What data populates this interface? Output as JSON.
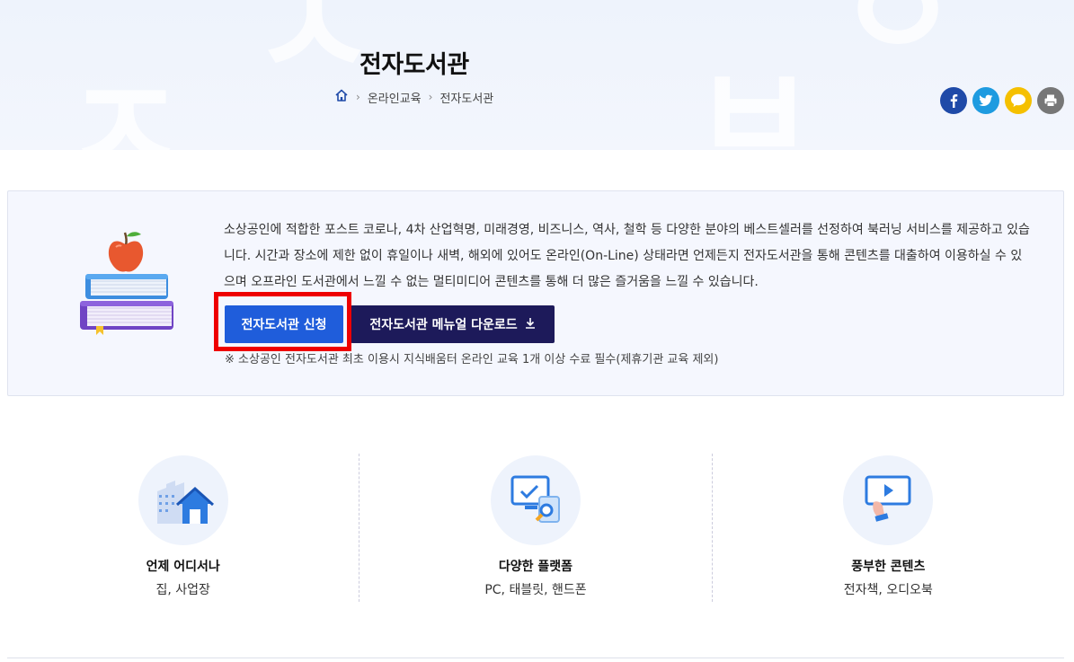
{
  "header": {
    "title": "전자도서관",
    "breadcrumb": [
      {
        "label": "온라인교육"
      },
      {
        "label": "전자도서관"
      }
    ],
    "share_icons": [
      {
        "icon": "facebook-icon",
        "glyph": "f",
        "color": "#1f4aa8"
      },
      {
        "icon": "twitter-icon",
        "glyph": "t",
        "color": "#1e9be0"
      },
      {
        "icon": "kakaotalk-icon",
        "glyph": "k",
        "color": "#f5c000"
      },
      {
        "icon": "print-icon",
        "glyph": "p",
        "color": "#777777"
      }
    ]
  },
  "info": {
    "description": "소상공인에 적합한 포스트 코로나, 4차 산업혁명, 미래경영, 비즈니스, 역사, 철학 등 다양한 분야의 베스트셀러를 선정하여 북러닝 서비스를 제공하고 있습니다. 시간과 장소에 제한 없이 휴일이나 새벽, 해외에 있어도 온라인(On-Line) 상태라면 언제든지 전자도서관을 통해 콘텐츠를 대출하여 이용하실 수 있으며 오프라인 도서관에서 느낄 수 없는 멀티미디어 콘텐츠를 통해 더 많은 즐거움을 느낄 수 있습니다.",
    "apply_button": "전자도서관 신청",
    "manual_button": "전자도서관 메뉴얼 다운로드",
    "note": "※ 소상공인 전자도서관 최초 이용시 지식배움터 온라인 교육 1개 이상 수료 필수(제휴기관 교육 제외)"
  },
  "features": [
    {
      "title": "언제 어디서나",
      "subtitle": "집, 사업장",
      "icon": "building-home-icon"
    },
    {
      "title": "다양한 플랫폼",
      "subtitle": "PC, 태블릿, 핸드폰",
      "icon": "devices-icon"
    },
    {
      "title": "풍부한 콘텐츠",
      "subtitle": "전자책, 오디오북",
      "icon": "video-content-icon"
    }
  ],
  "colors": {
    "primary": "#1f5ddb",
    "navy": "#1d1a5a",
    "highlight": "#ee0000"
  }
}
